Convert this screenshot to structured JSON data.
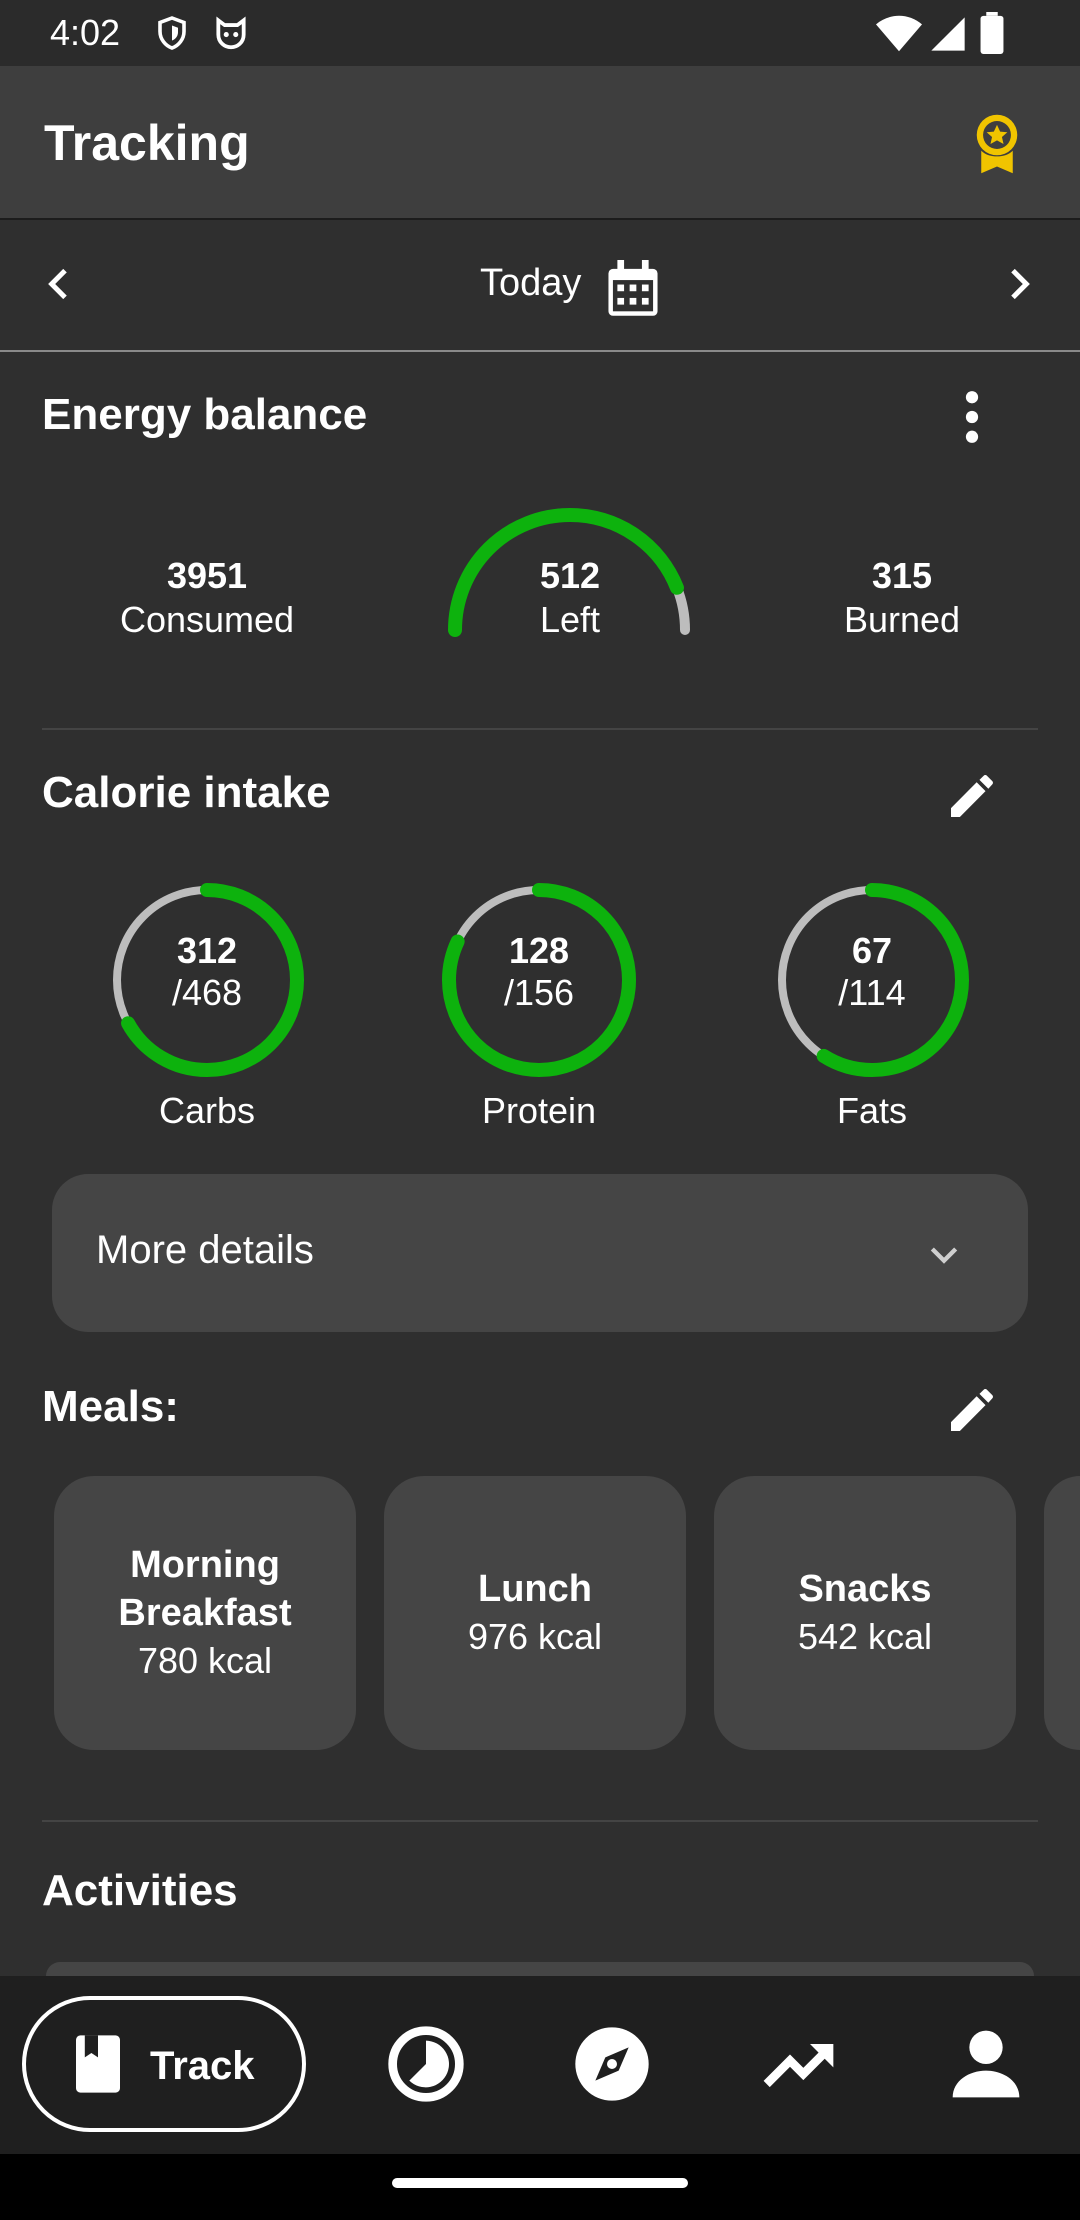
{
  "status_bar": {
    "time": "4:02"
  },
  "app_bar": {
    "title": "Tracking",
    "award_icon": "award-icon"
  },
  "date_nav": {
    "label": "Today",
    "prev_icon": "chevron-left-icon",
    "next_icon": "chevron-right-icon",
    "calendar_icon": "calendar-icon"
  },
  "energy": {
    "title": "Energy balance",
    "consumed_value": "3951",
    "consumed_label": "Consumed",
    "left_value": "512",
    "left_label": "Left",
    "burned_value": "315",
    "burned_label": "Burned",
    "progress": 0.88
  },
  "calorie_intake": {
    "title": "Calorie intake",
    "macros": [
      {
        "value": "312",
        "goal": "/468",
        "label": "Carbs",
        "progress": 0.67
      },
      {
        "value": "128",
        "goal": "/156",
        "label": "Protein",
        "progress": 0.82
      },
      {
        "value": "67",
        "goal": "/114",
        "label": "Fats",
        "progress": 0.59
      }
    ]
  },
  "more_details": {
    "label": "More details"
  },
  "meals": {
    "title": "Meals:",
    "items": [
      {
        "name": "Morning Breakfast",
        "kcal": "780 kcal"
      },
      {
        "name": "Lunch",
        "kcal": "976 kcal"
      },
      {
        "name": "Snacks",
        "kcal": "542 kcal"
      }
    ]
  },
  "activities": {
    "title": "Activities"
  },
  "bottom_nav": {
    "track_label": "Track"
  },
  "colors": {
    "accent": "#0db20d",
    "track_grey": "#bdbdbd",
    "award": "#f0c400"
  }
}
